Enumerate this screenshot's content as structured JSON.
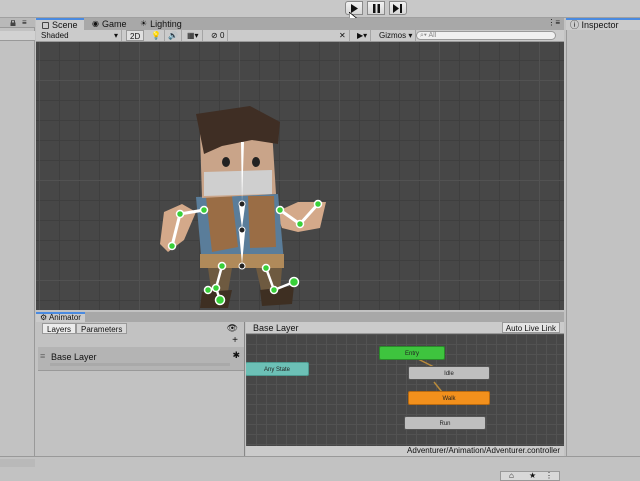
{
  "toolbar": {
    "play_icon": "play-icon",
    "pause_icon": "pause-icon",
    "step_icon": "step-icon"
  },
  "scene_tabs": [
    {
      "label": "Scene",
      "icon": "scene-icon",
      "active": true
    },
    {
      "label": "Game",
      "icon": "game-icon",
      "active": false
    },
    {
      "label": "Lighting",
      "icon": "lighting-icon",
      "active": false
    }
  ],
  "scene_toolbar": {
    "shading_mode": "Shaded",
    "mode_2d": "2D",
    "fx_count": "0",
    "gizmos_label": "Gizmos",
    "search_placeholder": "All"
  },
  "inspector": {
    "tab_label": "Inspector"
  },
  "animator": {
    "tab_label": "Animator",
    "left_tabs": [
      "Layers",
      "Parameters"
    ],
    "layers": [
      {
        "name": "Base Layer"
      }
    ],
    "breadcrumb": "Base Layer",
    "auto_live_link": "Auto Live Link",
    "controller_path": "Adventurer/Animation/Adventurer.controller",
    "states": [
      {
        "name": "Entry",
        "color": "#3ec43e"
      },
      {
        "name": "Any State",
        "color": "#6cc0b6"
      },
      {
        "name": "Idle",
        "color": "#bfbfbf"
      },
      {
        "name": "Walk",
        "color": "#f2901c"
      },
      {
        "name": "Run",
        "color": "#bfbfbf"
      }
    ]
  },
  "colors": {
    "accent": "#4a8ae0",
    "scene_bg": "#474747",
    "bone_joint": "#39d039"
  }
}
